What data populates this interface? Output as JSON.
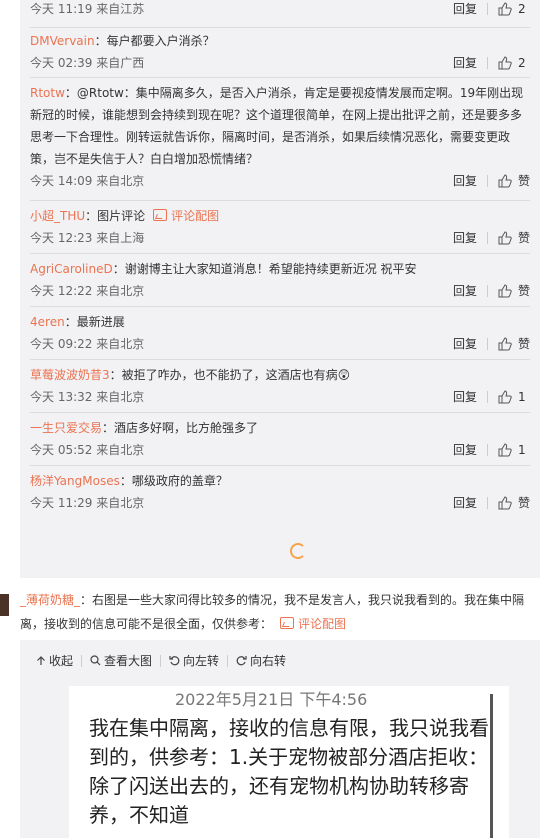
{
  "comments": [
    {
      "user": "",
      "text": "",
      "time": "今天 11:19 来自江苏",
      "reply": "回复",
      "likes": "2"
    },
    {
      "user": "DMVervain",
      "text": "：每户都要入户消杀？",
      "time": "今天 02:39 来自广西",
      "reply": "回复",
      "likes": "2"
    },
    {
      "user": "Rtotw",
      "text": "：@Rtotw：集中隔离多久，是否入户消杀，肯定是要视疫情发展而定啊。19年刚出现新冠的时候，谁能想到会持续到现在呢？这个道理很简单，在网上提出批评之前，还是要多多思考一下合理性。刚转运就告诉你，隔离时间，是否消杀，如果后续情况恶化，需要变更政策，岂不是失信于人？白白增加恐慌情绪？",
      "time": "今天 14:09 来自北京",
      "reply": "回复",
      "likes": "赞"
    },
    {
      "user": "小超_THU",
      "text": "：图片评论",
      "pic": "评论配图",
      "time": "今天 12:23 来自上海",
      "reply": "回复",
      "likes": "赞"
    },
    {
      "user": "AgriCarolineD",
      "text": "：谢谢博主让大家知道消息！希望能持续更新近况 祝平安",
      "time": "今天 12:22 来自北京",
      "reply": "回复",
      "likes": "赞"
    },
    {
      "user": "4eren",
      "text": "：最新进展",
      "time": "今天 09:22 来自北京",
      "reply": "回复",
      "likes": "赞"
    },
    {
      "user": "草莓波波奶昔3",
      "text": "：被拒了咋办，也不能扔了，这酒店也有病",
      "emoji": "😲",
      "time": "今天 13:32 来自北京",
      "reply": "回复",
      "likes": "1"
    },
    {
      "user": "一生只爱交易",
      "text": "：酒店多好啊，比方舱强多了",
      "time": "今天 05:52 来自北京",
      "reply": "回复",
      "likes": "1"
    },
    {
      "user": "杨洋YangMoses",
      "text": "：哪级政府的盖章？",
      "time": "今天 11:29 来自北京",
      "reply": "回复",
      "likes": "赞"
    }
  ],
  "main_comment": {
    "user": "_薄荷奶糖_",
    "text": "：右图是一些大家问得比较多的情况，我不是发言人，我只说我看到的。我在集中隔离，接收到的信息可能不是很全面，仅供参考：",
    "pic": "评论配图"
  },
  "toolbar": {
    "collapse": "收起",
    "view_large": "查看大图",
    "rotate_left": "向左转",
    "rotate_right": "向右转"
  },
  "image": {
    "date": "2022年5月21日 下午4:56",
    "text": "我在集中隔离，接收的信息有限，我只说我看到的，供参考：1.关于宠物被部分酒店拒收：除了闪送出去的，还有宠物机构协助转移寄养，不知道"
  },
  "colors": {
    "username": "#eb7350",
    "panel_bg": "#f2f2f5",
    "spinner": "#f7a24b"
  }
}
